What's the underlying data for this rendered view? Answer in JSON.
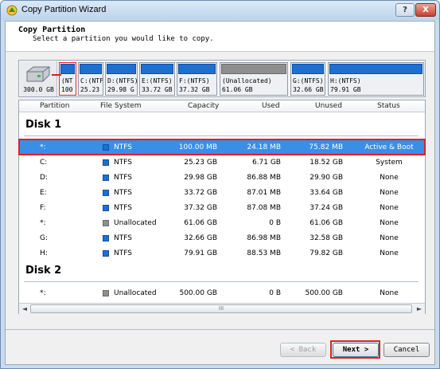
{
  "window": {
    "title": "Copy Partition Wizard",
    "help_label": "?",
    "close_label": "X"
  },
  "header": {
    "title": "Copy Partition",
    "subtitle": "Select a partition you would like to copy."
  },
  "disk_map": {
    "disk_size": "300.0 GB",
    "partitions": [
      {
        "l1": "(NT",
        "l2": "100",
        "type": "ntfs"
      },
      {
        "l1": "C:(NTF",
        "l2": "25.23",
        "type": "ntfs"
      },
      {
        "l1": "D:(NTFS)",
        "l2": "29.98 G",
        "type": "ntfs"
      },
      {
        "l1": "E:(NTFS)",
        "l2": "33.72 GB",
        "type": "ntfs"
      },
      {
        "l1": "F:(NTFS)",
        "l2": "37.32 GB",
        "type": "ntfs"
      },
      {
        "l1": "(Unallocated)",
        "l2": "61.06 GB",
        "type": "unallocated"
      },
      {
        "l1": "G:(NTFS)",
        "l2": "32.66 GB",
        "type": "ntfs"
      },
      {
        "l1": "H:(NTFS)",
        "l2": "79.91 GB",
        "type": "ntfs"
      }
    ]
  },
  "table": {
    "columns": [
      "Partition",
      "File System",
      "Capacity",
      "Used",
      "Unused",
      "Status"
    ],
    "disk1_label": "Disk 1",
    "disk2_label": "Disk 2",
    "disk1_rows": [
      {
        "partition": "*:",
        "fs": "NTFS",
        "capacity": "100.00 MB",
        "used": "24.18 MB",
        "unused": "75.82 MB",
        "status": "Active & Boot"
      },
      {
        "partition": "C:",
        "fs": "NTFS",
        "capacity": "25.23 GB",
        "used": "6.71 GB",
        "unused": "18.52 GB",
        "status": "System"
      },
      {
        "partition": "D:",
        "fs": "NTFS",
        "capacity": "29.98 GB",
        "used": "86.88 MB",
        "unused": "29.90 GB",
        "status": "None"
      },
      {
        "partition": "E:",
        "fs": "NTFS",
        "capacity": "33.72 GB",
        "used": "87.01 MB",
        "unused": "33.64 GB",
        "status": "None"
      },
      {
        "partition": "F:",
        "fs": "NTFS",
        "capacity": "37.32 GB",
        "used": "87.08 MB",
        "unused": "37.24 GB",
        "status": "None"
      },
      {
        "partition": "*:",
        "fs": "Unallocated",
        "capacity": "61.06 GB",
        "used": "0 B",
        "unused": "61.06 GB",
        "status": "None"
      },
      {
        "partition": "G:",
        "fs": "NTFS",
        "capacity": "32.66 GB",
        "used": "86.98 MB",
        "unused": "32.58 GB",
        "status": "None"
      },
      {
        "partition": "H:",
        "fs": "NTFS",
        "capacity": "79.91 GB",
        "used": "88.53 MB",
        "unused": "79.82 GB",
        "status": "None"
      }
    ],
    "disk2_rows": [
      {
        "partition": "*:",
        "fs": "Unallocated",
        "capacity": "500.00 GB",
        "used": "0 B",
        "unused": "500.00 GB",
        "status": "None"
      }
    ],
    "scroll_left": "◄",
    "scroll_right": "►",
    "scroll_grip": "III"
  },
  "buttons": {
    "back": "< Back",
    "next": "Next >",
    "cancel": "Cancel"
  },
  "colors": {
    "ntfs": "#1f6fd0",
    "unallocated": "#8e8e8e",
    "selection": "#3a8ee6",
    "highlight": "#e02020"
  }
}
